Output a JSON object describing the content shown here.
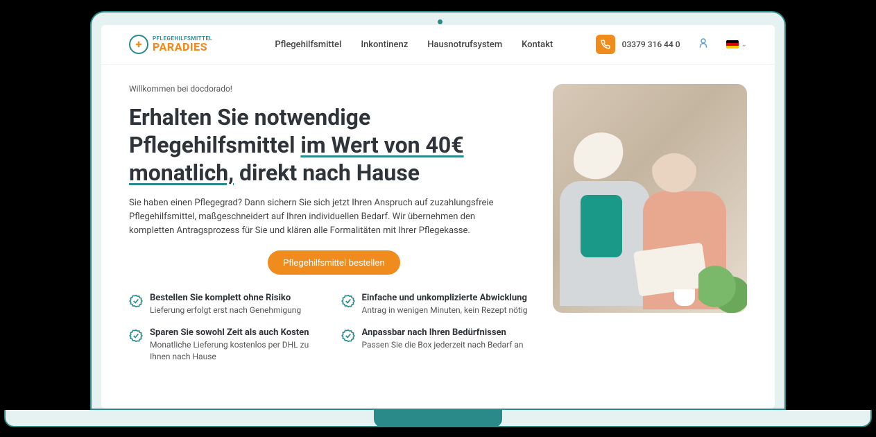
{
  "logo": {
    "small_text": "PFLEGEHILFSMITTEL",
    "big_text": "PARADIES"
  },
  "nav": {
    "item0": "Pflegehilfsmittel",
    "item1": "Inkontinenz",
    "item2": "Hausnotrufsystem",
    "item3": "Kontakt"
  },
  "phone": "03379 316 44 0",
  "hero": {
    "welcome": "Willkommen bei docdorado!",
    "title_part1": "Erhalten Sie notwendige Pflegehilfsmittel ",
    "title_underline": "im Wert von 40€ monatlich,",
    "title_part2": " direkt nach Hause",
    "description": "Sie haben einen Pflegegrad? Dann sichern Sie sich jetzt Ihren Anspruch auf zuzahlungsfreie Pflegehilfsmittel, maßgeschneidert auf Ihren individuellen Bedarf. Wir übernehmen den kompletten Antragsprozess für Sie und klären alle Formalitäten mit Ihrer Pflegekasse.",
    "cta": "Pflegehilfsmittel bestellen"
  },
  "features": [
    {
      "title": "Bestellen Sie komplett ohne Risiko",
      "desc": "Lieferung erfolgt erst nach Genehmigung"
    },
    {
      "title": "Einfache und unkomplizierte Abwicklung",
      "desc": "Antrag in wenigen Minuten, kein Rezept nötig"
    },
    {
      "title": "Sparen Sie sowohl Zeit als auch Kosten",
      "desc": "Monatliche Lieferung kostenlos per DHL zu Ihnen nach Hause"
    },
    {
      "title": "Anpassbar nach Ihren Bedürfnissen",
      "desc": "Passen Sie die Box jederzeit nach Bedarf an"
    }
  ]
}
